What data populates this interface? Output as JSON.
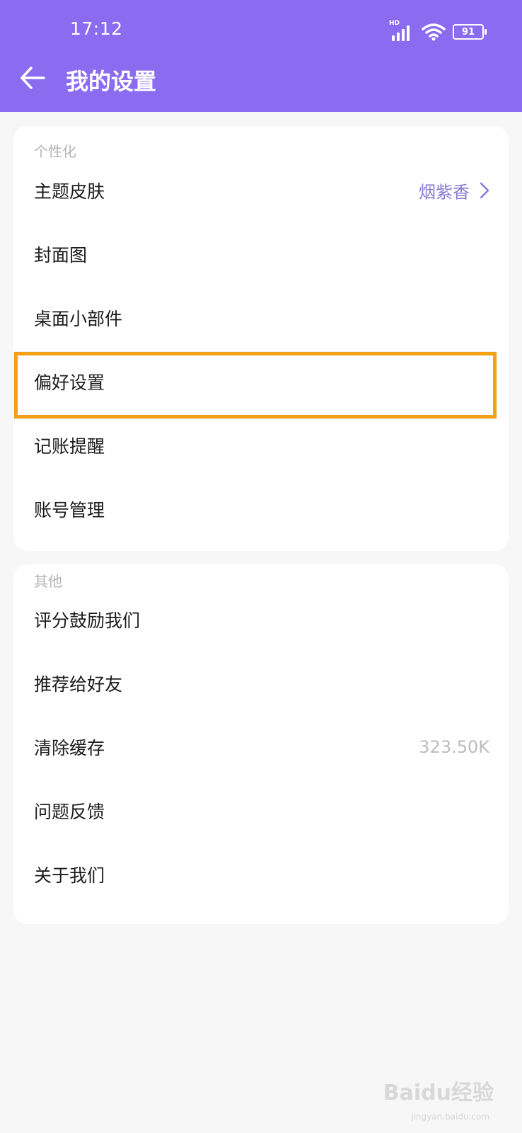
{
  "status_bar": {
    "time": "17:12",
    "network": "HD",
    "battery": "91"
  },
  "header": {
    "title": "我的设置"
  },
  "sections": [
    {
      "title": "个性化",
      "items": [
        {
          "label": "主题皮肤",
          "value": "烟紫香"
        },
        {
          "label": "封面图"
        },
        {
          "label": "桌面小部件"
        },
        {
          "label": "偏好设置",
          "highlighted": true
        },
        {
          "label": "记账提醒"
        },
        {
          "label": "账号管理"
        }
      ]
    },
    {
      "title": "其他",
      "items": [
        {
          "label": "评分鼓励我们"
        },
        {
          "label": "推荐给好友"
        },
        {
          "label": "清除缓存",
          "value": "323.50K"
        },
        {
          "label": "问题反馈"
        },
        {
          "label": "关于我们"
        }
      ]
    }
  ],
  "watermark": {
    "brand": "Baidu经验",
    "url": "jingyan.baidu.com"
  },
  "colors": {
    "header": "#8b6cf0",
    "accent_value": "#8a7bd6",
    "highlight": "#f6a018",
    "background": "#f7f7f7"
  }
}
